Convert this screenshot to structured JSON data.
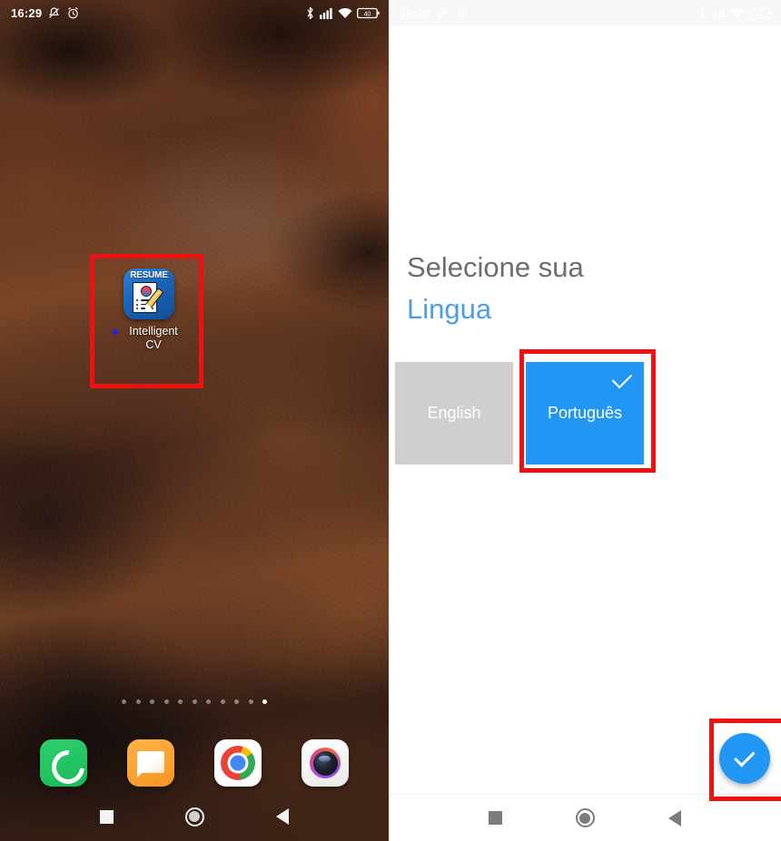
{
  "left_phone": {
    "status_bar": {
      "time": "16:29",
      "icons_left": [
        "silent-mode-icon",
        "alarm-icon"
      ],
      "icons_right": [
        "bluetooth-icon",
        "cellular-signal-icon",
        "wifi-icon",
        "battery-icon"
      ],
      "battery_level": "40"
    },
    "home_app": {
      "icon_title": "RESUME",
      "label": "Intelligent CV",
      "notification_dot_color": "#2222ee"
    },
    "page_indicator": {
      "count": 11,
      "active_index": 10
    },
    "dock": [
      {
        "name": "phone",
        "label": "Phone"
      },
      {
        "name": "messages",
        "label": "Messages"
      },
      {
        "name": "chrome",
        "label": "Chrome"
      },
      {
        "name": "camera",
        "label": "Camera"
      }
    ],
    "nav_bar": {
      "recents": "recents-square",
      "home": "home-circle",
      "back": "back-triangle"
    }
  },
  "right_phone": {
    "status_bar": {
      "time": "16:29",
      "battery_level": "40",
      "background": "#f7f7f7"
    },
    "heading": {
      "line1": "Selecione sua",
      "line2": "Lingua",
      "line1_color": "#6e6e6e",
      "line2_color": "#4a9fe8"
    },
    "languages": [
      {
        "label": "English",
        "selected": false,
        "background": "#cfcfcf"
      },
      {
        "label": "Português",
        "selected": true,
        "background": "#2196f3"
      }
    ],
    "confirm_fab": {
      "icon": "check-icon",
      "color": "#2196f3"
    },
    "nav_bar": {
      "recents": "recents-square",
      "home": "home-circle",
      "back": "back-triangle"
    }
  },
  "annotations": {
    "color": "#ee1111",
    "boxes": [
      {
        "name": "app-icon-highlight",
        "target": "Intelligent CV"
      },
      {
        "name": "language-tile-highlight",
        "target": "Português"
      },
      {
        "name": "confirm-button-highlight",
        "target": "check-fab"
      }
    ]
  }
}
